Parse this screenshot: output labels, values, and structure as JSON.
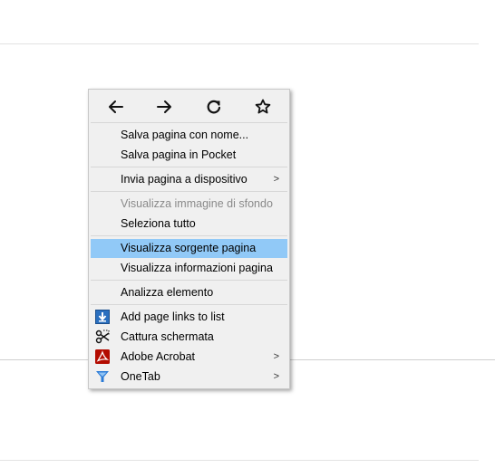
{
  "menu": {
    "nav": [
      "back-arrow-icon",
      "forward-arrow-icon",
      "reload-icon",
      "bookmark-star-icon"
    ],
    "items": [
      {
        "label": "Salva pagina con nome..."
      },
      {
        "label": "Salva pagina in Pocket"
      },
      {
        "label": "Invia pagina a dispositivo"
      },
      {
        "label": "Visualizza immagine di sfondo"
      },
      {
        "label": "Seleziona tutto"
      },
      {
        "label": "Visualizza sorgente pagina"
      },
      {
        "label": "Visualizza informazioni pagina"
      },
      {
        "label": "Analizza elemento"
      },
      {
        "label": "Add page links to list"
      },
      {
        "label": "Cattura schermata"
      },
      {
        "label": "Adobe Acrobat"
      },
      {
        "label": "OneTab"
      }
    ],
    "submenu_arrow": ">",
    "highlight_color": "#91c9f7"
  }
}
